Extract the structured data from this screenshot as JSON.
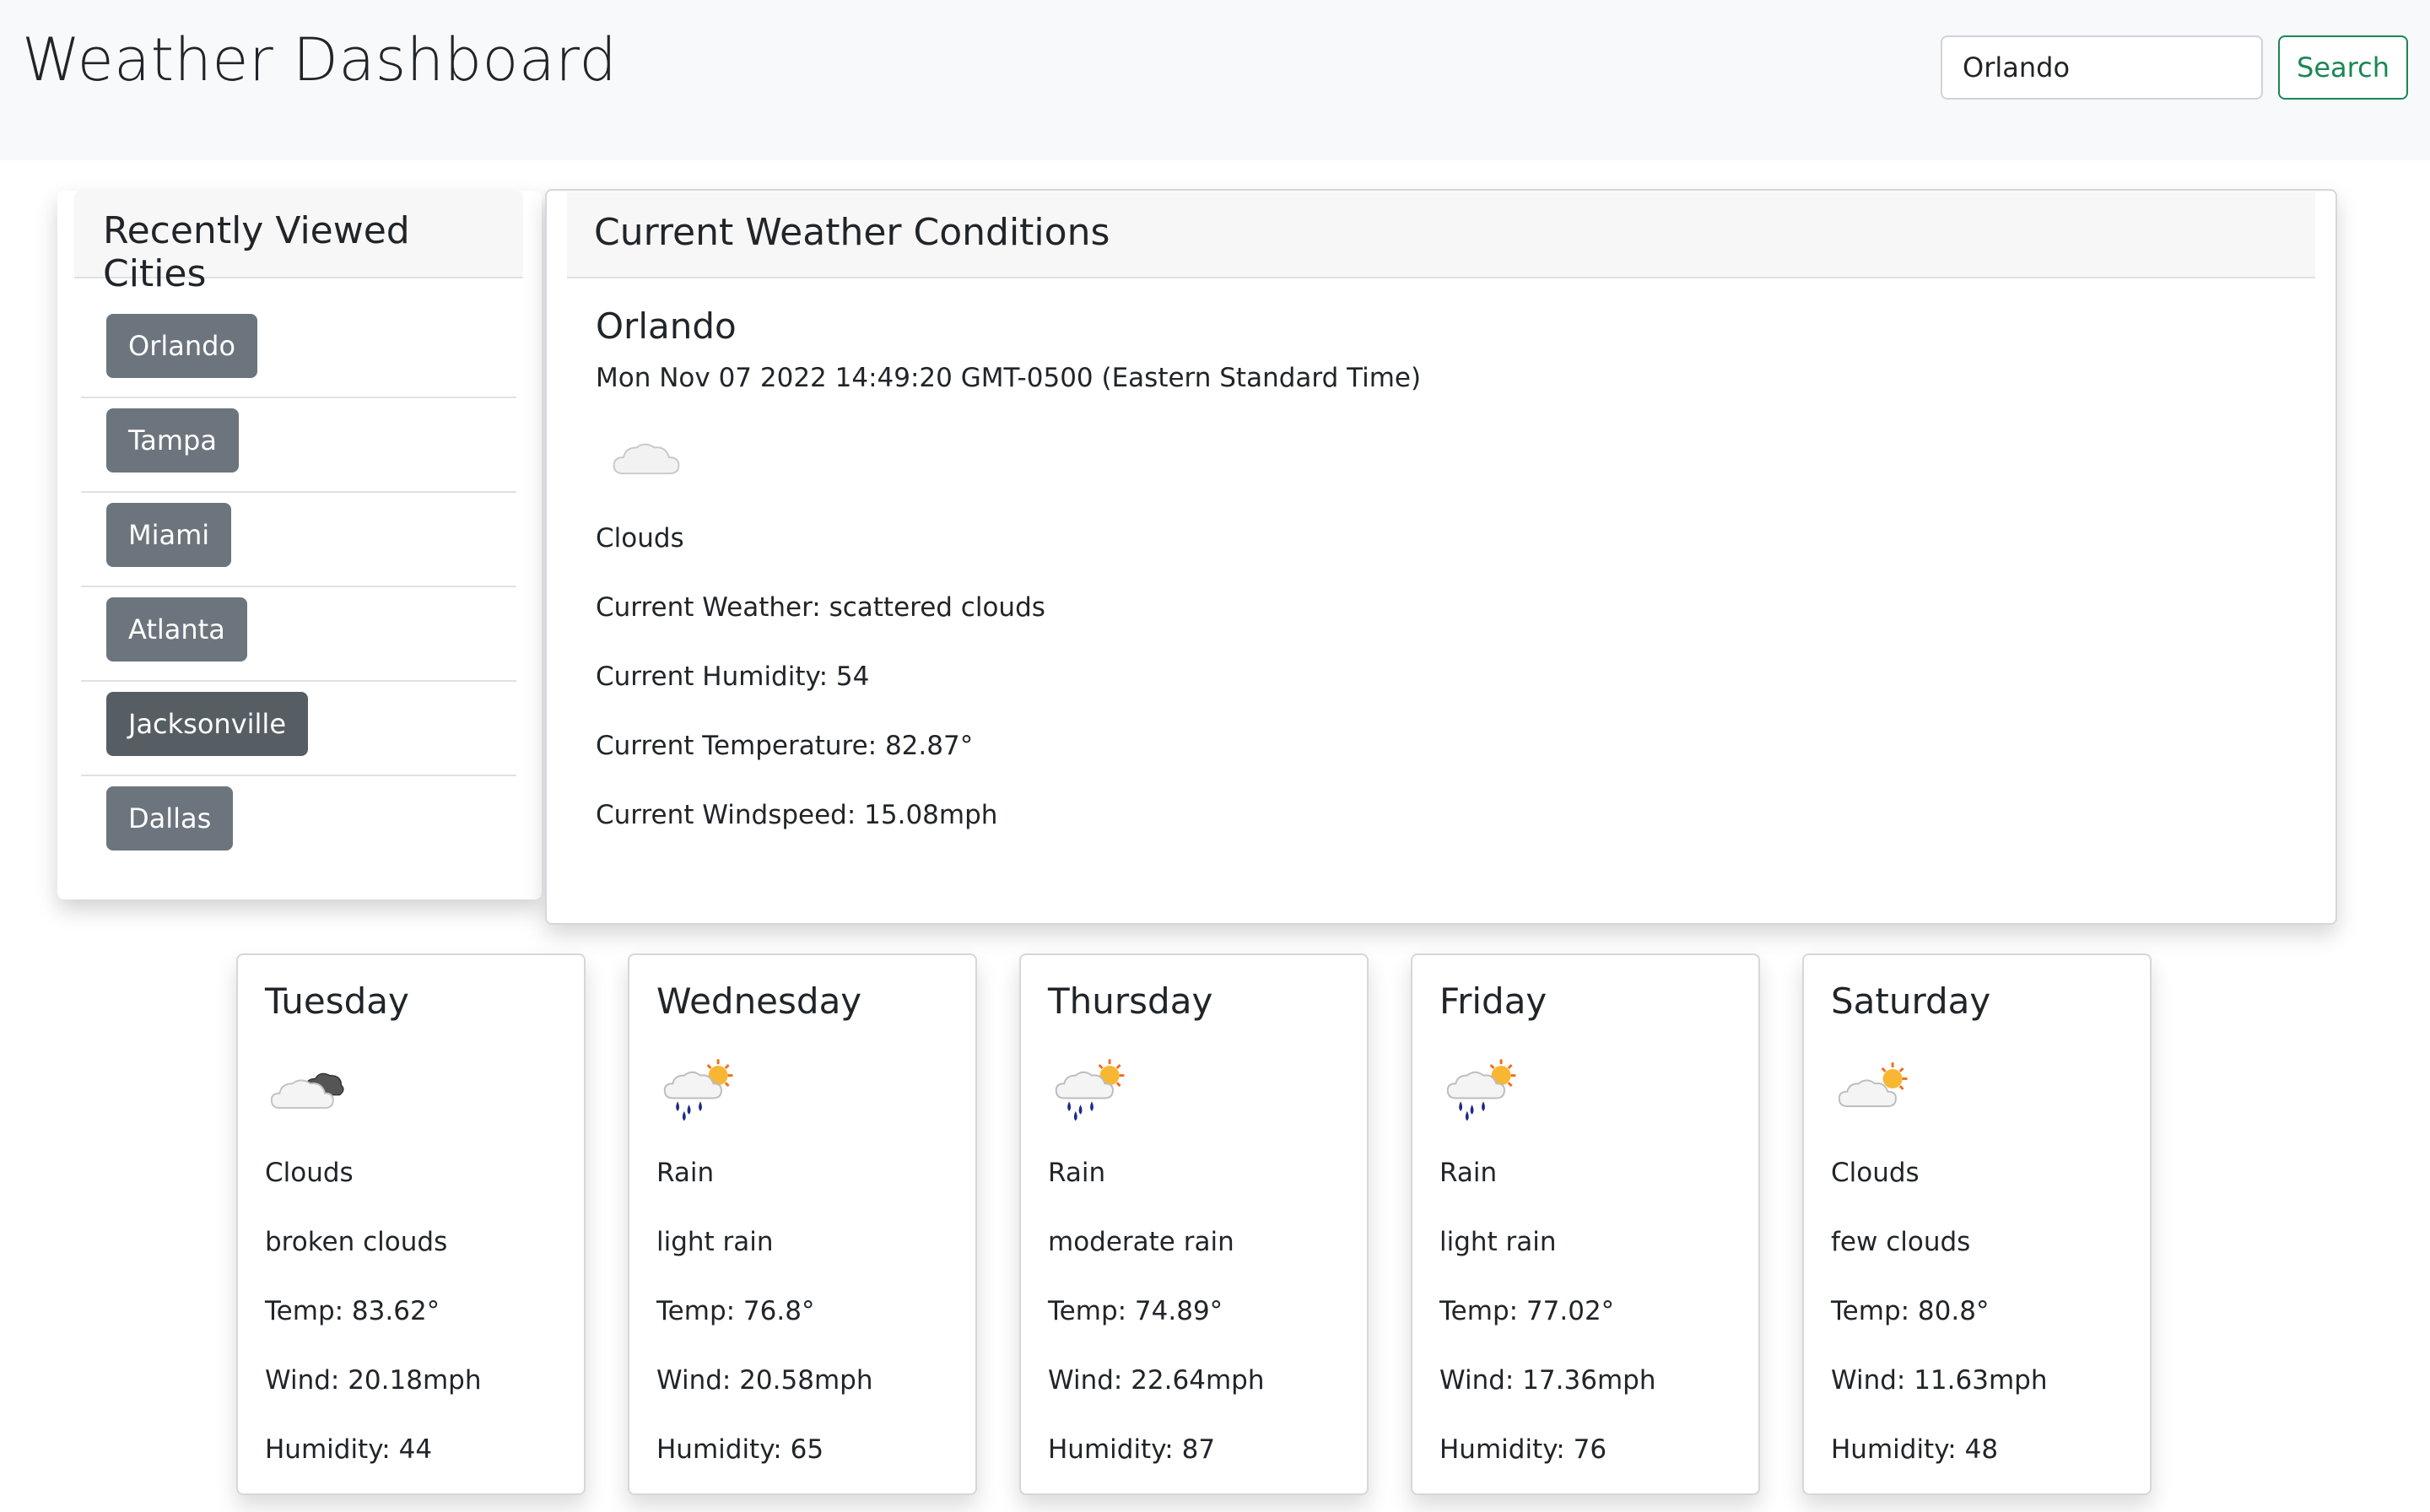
{
  "header": {
    "title": "Weather Dashboard",
    "search": {
      "value": "Orlando",
      "placeholder": "",
      "button_label": "Search"
    }
  },
  "recent": {
    "title": "Recently Viewed Cities",
    "cities": [
      "Orlando",
      "Tampa",
      "Miami",
      "Atlanta",
      "Jacksonville",
      "Dallas"
    ]
  },
  "current": {
    "title": "Current Weather Conditions",
    "city": "Orlando",
    "datetime": "Mon Nov 07 2022 14:49:20 GMT-0500 (Eastern Standard Time)",
    "icon": "cloud-icon",
    "main": "Clouds",
    "weather": "Current Weather: scattered clouds",
    "humidity": "Current Humidity: 54",
    "temperature": "Current Temperature: 82.87°",
    "windspeed": "Current Windspeed: 15.08mph"
  },
  "forecast": [
    {
      "day": "Tuesday",
      "icon": "broken-clouds-icon",
      "main": "Clouds",
      "description": "broken clouds",
      "temp": "Temp: 83.62°",
      "wind": "Wind: 20.18mph",
      "humidity": "Humidity: 44"
    },
    {
      "day": "Wednesday",
      "icon": "rain-sun-icon",
      "main": "Rain",
      "description": "light rain",
      "temp": "Temp: 76.8°",
      "wind": "Wind: 20.58mph",
      "humidity": "Humidity: 65"
    },
    {
      "day": "Thursday",
      "icon": "rain-sun-icon",
      "main": "Rain",
      "description": "moderate rain",
      "temp": "Temp: 74.89°",
      "wind": "Wind: 22.64mph",
      "humidity": "Humidity: 87"
    },
    {
      "day": "Friday",
      "icon": "rain-sun-icon",
      "main": "Rain",
      "description": "light rain",
      "temp": "Temp: 77.02°",
      "wind": "Wind: 17.36mph",
      "humidity": "Humidity: 76"
    },
    {
      "day": "Saturday",
      "icon": "few-clouds-sun-icon",
      "main": "Clouds",
      "description": "few clouds",
      "temp": "Temp: 80.8°",
      "wind": "Wind: 11.63mph",
      "humidity": "Humidity: 48"
    }
  ],
  "colors": {
    "header_bg": "#f8f9fa",
    "search_button": "#198754",
    "city_button": "#6c757d",
    "city_button_active": "#565e64"
  }
}
